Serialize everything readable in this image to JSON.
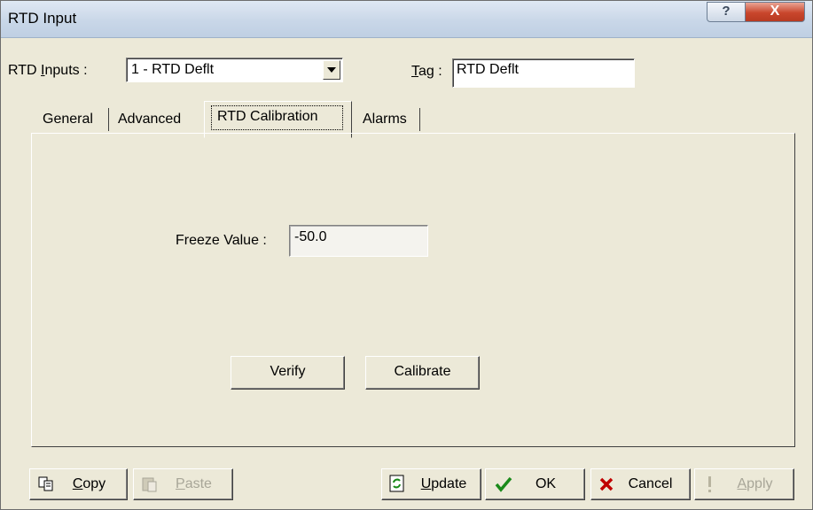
{
  "window": {
    "title": "RTD Input",
    "help_label": "?",
    "close_label": "X"
  },
  "header": {
    "rtd_inputs_label_pre": "RTD ",
    "rtd_inputs_label_u": "I",
    "rtd_inputs_label_post": "nputs :",
    "rtd_inputs_value": "1 - RTD Deflt",
    "tag_label_u": "T",
    "tag_label_post": "ag :",
    "tag_value": "RTD Deflt"
  },
  "tabs": [
    {
      "label": "General"
    },
    {
      "label": "Advanced"
    },
    {
      "label": "RTD Calibration",
      "active": true
    },
    {
      "label": "Alarms"
    }
  ],
  "calibration": {
    "freeze_label": "Freeze Value :",
    "freeze_value": "-50.0",
    "verify_label": "Verify",
    "calibrate_label": "Calibrate"
  },
  "footer": {
    "copy_u": "C",
    "copy_rest": "opy",
    "paste_u": "P",
    "paste_rest": "aste",
    "update_u": "U",
    "update_rest": "pdate",
    "ok_label": "OK",
    "cancel_label": "Cancel",
    "apply_u": "A",
    "apply_rest": "pply"
  },
  "icons": {
    "copy": "copy-icon",
    "paste": "paste-icon",
    "update": "update-icon",
    "ok": "checkmark-icon",
    "cancel": "x-icon",
    "apply": "exclamation-icon"
  },
  "colors": {
    "ok_check": "#1a8a1a",
    "cancel_x": "#c00000",
    "disabled_text": "#a8a698"
  }
}
